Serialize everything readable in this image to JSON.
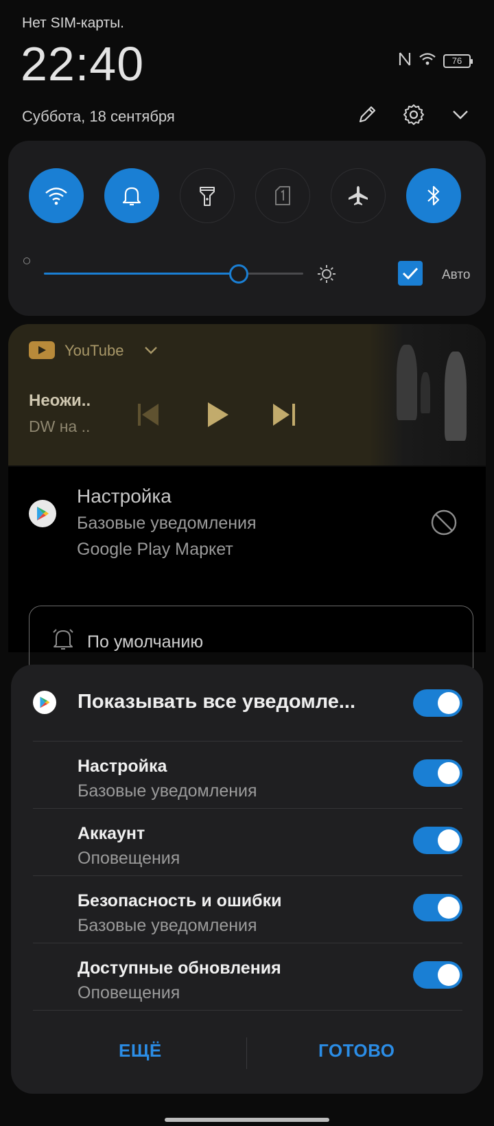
{
  "status": {
    "sim_text": "Нет SIM-карты.",
    "time": "22:40",
    "date": "Суббота, 18 сентября",
    "battery": "76"
  },
  "header_actions": {
    "icons": [
      "edit-icon",
      "settings-icon",
      "chevron-down-icon"
    ]
  },
  "quick_settings": {
    "tiles": [
      {
        "icon": "wifi-icon",
        "on": true
      },
      {
        "icon": "bell-icon",
        "on": true
      },
      {
        "icon": "flashlight-icon",
        "on": false
      },
      {
        "icon": "sim-icon",
        "on": false
      },
      {
        "icon": "airplane-icon",
        "on": false
      },
      {
        "icon": "bluetooth-icon",
        "on": true
      }
    ],
    "brightness_fraction": 0.75,
    "auto_label": "Авто",
    "auto_checked": true,
    "accent_color": "#1a7fd4"
  },
  "media": {
    "app_name": "YouTube",
    "title": "Неожи..",
    "subtitle": "DW на ..",
    "controls": [
      "previous-icon",
      "play-icon",
      "next-icon"
    ]
  },
  "notification": {
    "title": "Настройка",
    "line1": "Базовые уведомления",
    "line2": "Google Play Маркет",
    "default_label": "По умолчанию"
  },
  "sheet": {
    "main_label": "Показывать все уведомле...",
    "rows": [
      {
        "title": "Настройка",
        "subtitle": "Базовые уведомления"
      },
      {
        "title": "Аккаунт",
        "subtitle": "Оповещения"
      },
      {
        "title": "Безопасность и ошибки",
        "subtitle": "Базовые уведомления"
      },
      {
        "title": "Доступные обновления",
        "subtitle": "Оповещения"
      }
    ],
    "more_label": "ЕЩЁ",
    "done_label": "ГОТОВО"
  }
}
